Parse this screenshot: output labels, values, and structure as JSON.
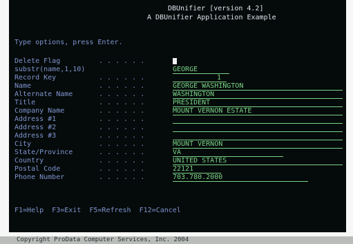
{
  "header": {
    "line1": "DBUnifier [version 4.2]",
    "line2": "A DBUnifier Application Example"
  },
  "instruction": "Type options, press Enter.",
  "fields": [
    {
      "label": "Delete Flag",
      "value": ""
    },
    {
      "label": "substr(name,1,10)",
      "value": "GEORGE"
    },
    {
      "label": "Record Key",
      "value": "1"
    },
    {
      "label": "Name",
      "value": "GEORGE WASHINGTON"
    },
    {
      "label": "Alternate Name",
      "value": "WASHINGTON"
    },
    {
      "label": "Title",
      "value": "PRESIDENT"
    },
    {
      "label": "Company Name",
      "value": "MOUNT VERNON ESTATE"
    },
    {
      "label": "Address #1",
      "value": ""
    },
    {
      "label": "Address #2",
      "value": ""
    },
    {
      "label": "Address #3",
      "value": ""
    },
    {
      "label": "City",
      "value": "MOUNT VERNON"
    },
    {
      "label": "State/Province",
      "value": "VA"
    },
    {
      "label": "Country",
      "value": "UNITED STATES"
    },
    {
      "label": "Postal Code",
      "value": "22121"
    },
    {
      "label": "Phone Number",
      "value": "703.780.2000"
    }
  ],
  "fkeys": "F1=Help  F3=Exit  F5=Refresh  F12=Cancel",
  "copyright": "Copyright ProData Computer Services, Inc. 2004",
  "colors": {
    "background": "#050a0a",
    "label": "#7f95cf",
    "value": "#7bd487",
    "header": "#dfe4ee"
  }
}
